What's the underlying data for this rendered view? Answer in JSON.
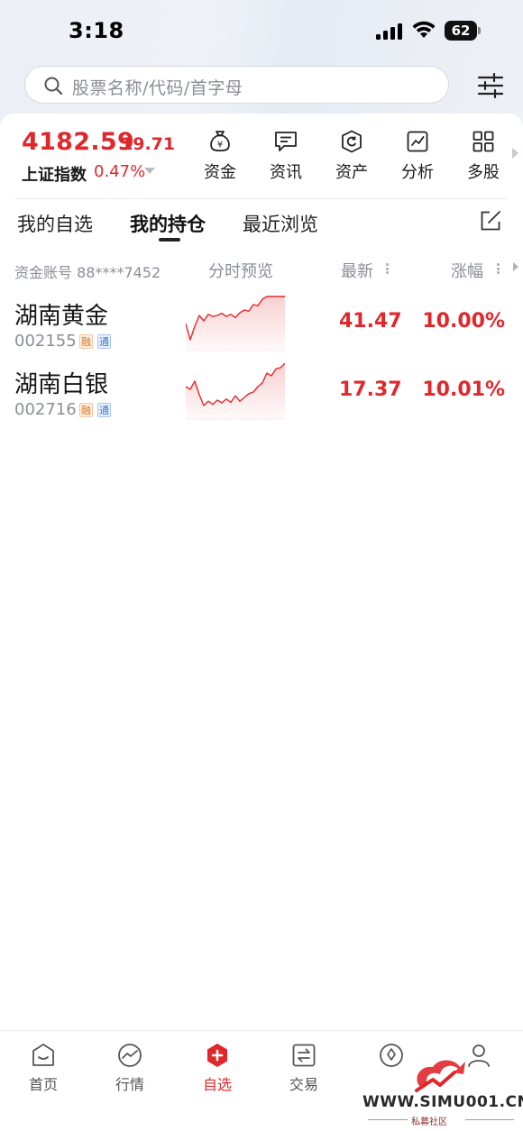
{
  "status_bar": {
    "time": "3:18",
    "battery": "62"
  },
  "search": {
    "placeholder": "股票名称/代码/首字母"
  },
  "index": {
    "value": "4182.59",
    "change": "19.71",
    "name": "上证指数",
    "percent": "0.47%"
  },
  "quick_actions": [
    {
      "label": "资金",
      "icon": "money-bag-icon"
    },
    {
      "label": "资讯",
      "icon": "message-icon"
    },
    {
      "label": "资产",
      "icon": "asset-icon"
    },
    {
      "label": "分析",
      "icon": "chart-icon"
    },
    {
      "label": "多股",
      "icon": "grid-icon"
    }
  ],
  "tabs": [
    {
      "label": "我的自选",
      "active": false
    },
    {
      "label": "我的持仓",
      "active": true
    },
    {
      "label": "最近浏览",
      "active": false
    }
  ],
  "list_header": {
    "account": "资金账号 88****7452",
    "preview": "分时预览",
    "latest": "最新",
    "change": "涨幅"
  },
  "stocks": [
    {
      "name": "湖南黄金",
      "code": "002155",
      "tag1": "融",
      "tag2": "通",
      "price": "41.47",
      "change": "10.00%",
      "intraday": [
        0.55,
        0.85,
        0.6,
        0.4,
        0.5,
        0.38,
        0.42,
        0.4,
        0.36,
        0.42,
        0.38,
        0.44,
        0.35,
        0.3,
        0.32,
        0.2,
        0.22,
        0.1,
        0.05,
        0.05,
        0.05,
        0.05,
        0.05
      ]
    },
    {
      "name": "湖南白银",
      "code": "002716",
      "tag1": "融",
      "tag2": "通",
      "price": "17.37",
      "change": "10.01%",
      "intraday": [
        0.45,
        0.5,
        0.35,
        0.6,
        0.8,
        0.72,
        0.78,
        0.7,
        0.75,
        0.68,
        0.74,
        0.62,
        0.72,
        0.65,
        0.58,
        0.55,
        0.45,
        0.38,
        0.2,
        0.25,
        0.12,
        0.1,
        0.02
      ]
    }
  ],
  "bottom_nav": [
    {
      "label": "首页",
      "icon": "home-icon",
      "active": false
    },
    {
      "label": "行情",
      "icon": "market-icon",
      "active": false
    },
    {
      "label": "自选",
      "icon": "watchlist-icon",
      "active": true
    },
    {
      "label": "交易",
      "icon": "trade-icon",
      "active": false
    },
    {
      "label": "",
      "icon": "fund-icon",
      "active": false
    },
    {
      "label": "",
      "icon": "profile-icon",
      "active": false
    }
  ],
  "watermark": {
    "text": "WWW.SIMU001.CN",
    "subtitle": "私募社区"
  },
  "colors": {
    "up_red": "#e0282c",
    "accent": "#e0282c",
    "muted": "#8b8e95"
  }
}
